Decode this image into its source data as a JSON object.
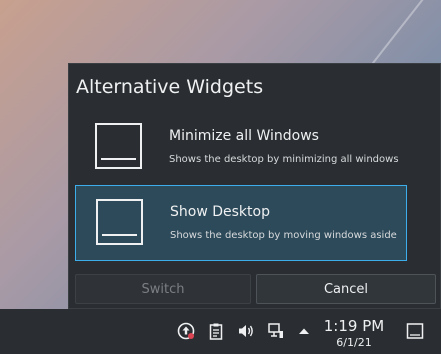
{
  "popup": {
    "title": "Alternative Widgets",
    "options": [
      {
        "title": "Minimize all Windows",
        "description": "Shows the desktop by minimizing all windows",
        "selected": false
      },
      {
        "title": "Show Desktop",
        "description": "Shows the desktop by moving windows aside",
        "selected": true
      }
    ],
    "switch_label": "Switch",
    "cancel_label": "Cancel"
  },
  "taskbar": {
    "time": "1:19 PM",
    "date": "6/1/21",
    "tray_icons": [
      "update-notifier-icon",
      "clipboard-icon",
      "volume-icon",
      "network-icon",
      "expand-tray-icon",
      "show-desktop-icon"
    ]
  },
  "colors": {
    "accent": "#3daee9",
    "panel": "#2a2e32",
    "selected_bg": "#2c4a5a",
    "notification_dot": "#da4453"
  }
}
